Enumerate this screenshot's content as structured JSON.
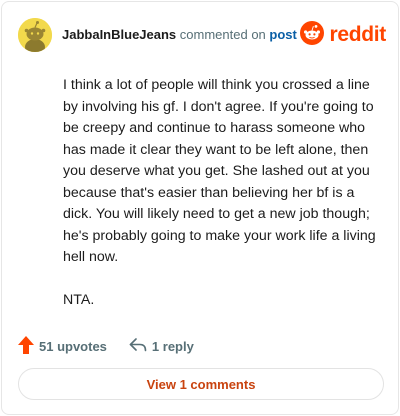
{
  "header": {
    "username": "JabbaInBlueJeans",
    "action": "commented on",
    "post_link": "post",
    "brand": "reddit"
  },
  "comment": {
    "paragraphs": [
      "I think a lot of people will think you crossed a line by involving his gf. I don't agree. If you're going to be creepy and continue to harass someone who has made it clear they want to be left alone, then you deserve what you get. She lashed out at you because that's easier than believing her bf is a dick. You will likely need to get a new job though; he's probably going to make your work life a living hell now.",
      "NTA."
    ]
  },
  "actions": {
    "upvotes": "51 upvotes",
    "replies": "1 reply"
  },
  "view_button": "View 1 comments",
  "icons": {
    "avatar": "snoo-avatar-icon",
    "brand": "reddit-logo-icon",
    "upvote": "upvote-arrow-icon",
    "reply": "reply-arrow-icon"
  },
  "colors": {
    "brand": "#ff4500",
    "link": "#0a5fa6",
    "view_button_text": "#c9430f",
    "avatar_bg": "#f2d94c"
  }
}
